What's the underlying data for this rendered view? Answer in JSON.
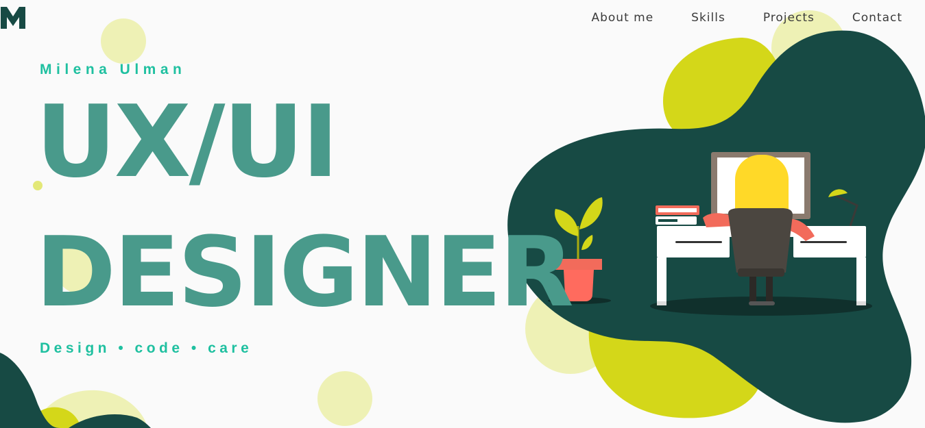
{
  "logo": {
    "letter": "M"
  },
  "nav": {
    "items": [
      {
        "label": "About me"
      },
      {
        "label": "Skills"
      },
      {
        "label": "Projects"
      },
      {
        "label": "Contact"
      }
    ]
  },
  "hero": {
    "name": "Milena Ulman",
    "title_line1": "UX/UI",
    "title_line2": "DESIGNER",
    "tagline": "Design • code • care"
  },
  "colors": {
    "background": "#fafafa",
    "dark_teal": "#174a44",
    "headline_teal": "#499a8b",
    "accent_teal": "#1fc0a0",
    "lime": "#d4d719",
    "pale_lime": "#eef1b5",
    "coral": "#f26b5b",
    "yellow_hair": "#ffd928"
  }
}
